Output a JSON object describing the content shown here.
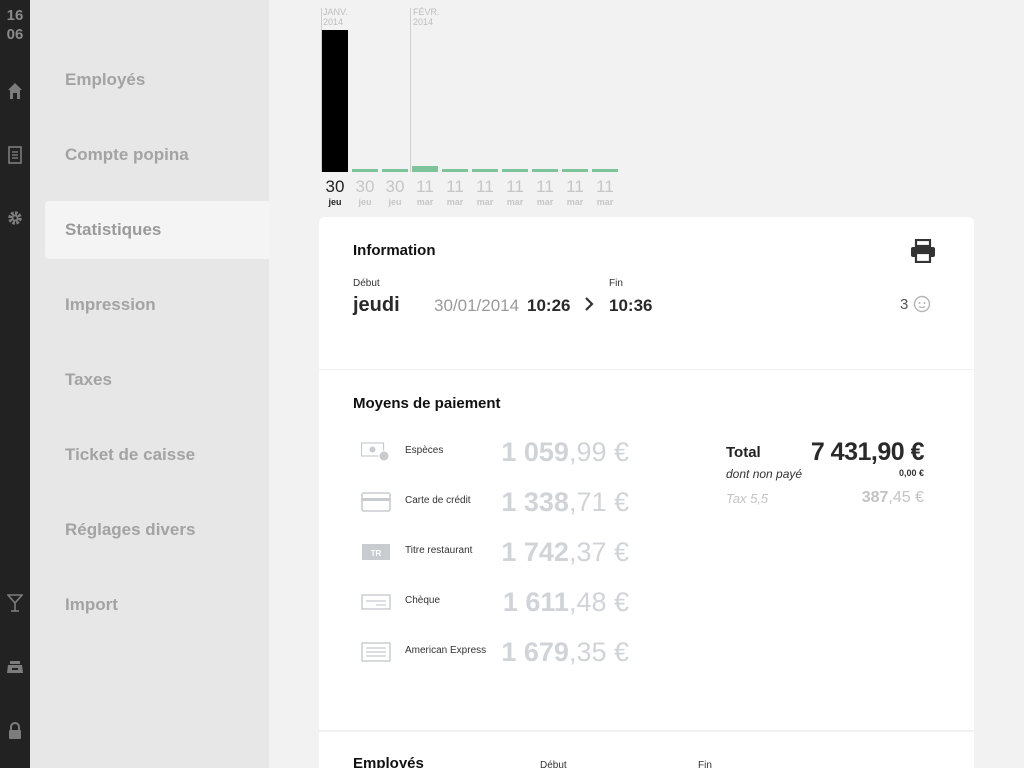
{
  "clock": {
    "hours": "16",
    "minutes": "06"
  },
  "rail": {
    "icons": [
      "home-icon",
      "document-icon",
      "gear-icon",
      "cocktail-icon",
      "cash-register-icon",
      "lock-icon"
    ]
  },
  "menu": {
    "items": [
      {
        "label": "Employés",
        "active": false
      },
      {
        "label": "Compte popina",
        "active": false
      },
      {
        "label": "Statistiques",
        "active": true
      },
      {
        "label": "Impression",
        "active": false
      },
      {
        "label": "Taxes",
        "active": false
      },
      {
        "label": "Ticket de caisse",
        "active": false
      },
      {
        "label": "Réglages divers",
        "active": false
      },
      {
        "label": "Import",
        "active": false
      }
    ]
  },
  "chart_data": {
    "type": "bar",
    "months": [
      {
        "name": "JANV.",
        "year": "2014"
      },
      {
        "name": "FÉVR.",
        "year": "2014"
      }
    ],
    "days": [
      {
        "day": "30",
        "weekday": "jeu",
        "value": 7431.9,
        "selected": true
      },
      {
        "day": "30",
        "weekday": "jeu",
        "value": 150,
        "selected": false
      },
      {
        "day": "30",
        "weekday": "jeu",
        "value": 150,
        "selected": false
      },
      {
        "day": "11",
        "weekday": "mar",
        "value": 300,
        "selected": false
      },
      {
        "day": "11",
        "weekday": "mar",
        "value": 150,
        "selected": false
      },
      {
        "day": "11",
        "weekday": "mar",
        "value": 150,
        "selected": false
      },
      {
        "day": "11",
        "weekday": "mar",
        "value": 150,
        "selected": false
      },
      {
        "day": "11",
        "weekday": "mar",
        "value": 150,
        "selected": false
      },
      {
        "day": "11",
        "weekday": "mar",
        "value": 150,
        "selected": false
      },
      {
        "day": "11",
        "weekday": "mar",
        "value": 150,
        "selected": false
      }
    ],
    "ylim": [
      0,
      7431.9
    ],
    "colors": {
      "selected": "#000000",
      "other": "#7dc49a"
    }
  },
  "info": {
    "title": "Information",
    "start_label": "Début",
    "end_label": "Fin",
    "day": "jeudi",
    "date": "30/01/2014",
    "start_time": "10:26",
    "end_time": "10:36",
    "covers": "3"
  },
  "payments": {
    "title": "Moyens de paiement",
    "rows": [
      {
        "icon": "cash-icon",
        "label": "Espèces",
        "int": "1 059",
        "dec": ",99 €"
      },
      {
        "icon": "credit-card-icon",
        "label": "Carte de crédit",
        "int": "1 338",
        "dec": ",71 €"
      },
      {
        "icon": "meal-voucher-icon",
        "label": "Titre restaurant",
        "int": "1 742",
        "dec": ",37 €"
      },
      {
        "icon": "check-icon",
        "label": "Chèque",
        "int": "1 611",
        "dec": ",48 €"
      },
      {
        "icon": "amex-icon",
        "label": "American Express",
        "int": "1 679",
        "dec": ",35 €"
      }
    ],
    "total_label": "Total",
    "total_value": "7 431,90 €",
    "unpaid_label": "dont non payé",
    "unpaid_value": "0,00 €",
    "tax_label": "Tax 5,5",
    "tax_int": "387",
    "tax_dec": ",45 €"
  },
  "employees": {
    "title": "Employés",
    "start_label": "Début",
    "end_label": "Fin"
  }
}
